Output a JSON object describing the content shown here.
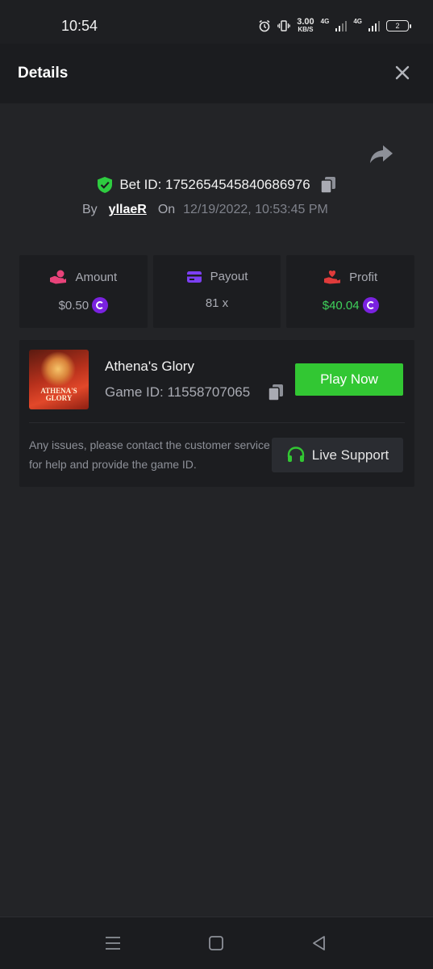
{
  "status_bar": {
    "time": "10:54",
    "data_rate": "3.00",
    "data_rate_unit": "KB/S",
    "network_1": "4G",
    "network_2": "4G",
    "battery": "2"
  },
  "header": {
    "title": "Details"
  },
  "bet": {
    "id_label": "Bet ID: 1752654545840686976",
    "by_label": "By",
    "username": "yllaeR",
    "on_label": "On",
    "date": "12/19/2022, 10:53:45 PM"
  },
  "stats": [
    {
      "label": "Amount",
      "value": "$0.50",
      "icon": "hand-coin-icon",
      "color": "#e8437a"
    },
    {
      "label": "Payout",
      "value": "81 x",
      "icon": "card-icon",
      "color": "#7b3ff2"
    },
    {
      "label": "Profit",
      "value": "$40.04",
      "icon": "hand-heart-icon",
      "color": "#e03b3b"
    }
  ],
  "game": {
    "name": "Athena's Glory",
    "id_label": "Game ID: 11558707065",
    "thumb_line1": "ATHENA'S",
    "thumb_line2": "GLORY",
    "play_label": "Play Now",
    "support_text": "Any issues, please contact the customer service for help and provide the game ID.",
    "support_label": "Live Support"
  },
  "colors": {
    "background": "#232427",
    "card": "#1c1d20",
    "accent_green": "#32c733",
    "profit_green": "#3fd15b",
    "coin_purple": "#7a22e0",
    "shield_green": "#2ecc40"
  }
}
